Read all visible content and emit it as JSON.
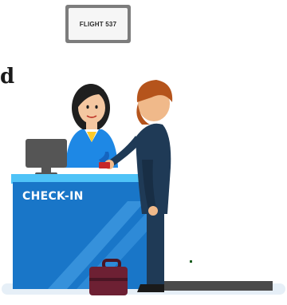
{
  "scene": {
    "flight_sign": {
      "text": "FLIGHT 537"
    },
    "text_fragment": "d",
    "counter": {
      "label": "CHECK-IN"
    }
  },
  "colors": {
    "counter_blue": "#1976c8",
    "counter_top": "#4fc3f7",
    "agent_uniform": "#1e88e5",
    "traveler_coat": "#1f3a56",
    "traveler_hair": "#b5541c",
    "suitcase": "#6d2033",
    "floor": "#e6eff7"
  }
}
